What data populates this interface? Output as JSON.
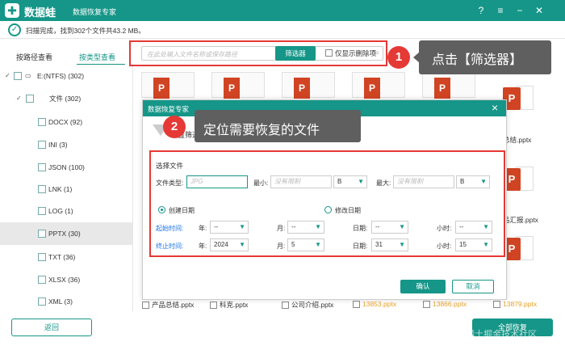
{
  "app": {
    "brand": "数据蛙",
    "title": "数据恢复专家"
  },
  "status": {
    "text": "扫描完成，找到302个文件共43.2 MB。"
  },
  "tabs": [
    {
      "label": "按路径查看"
    },
    {
      "label": "按类型查看"
    }
  ],
  "tree": [
    {
      "label": "E:(NTFS) (302)"
    },
    {
      "label": "文件 (302)"
    },
    {
      "label": "DOCX (92)"
    },
    {
      "label": "INI (3)"
    },
    {
      "label": "JSON (100)"
    },
    {
      "label": "LNK (1)"
    },
    {
      "label": "LOG (1)"
    },
    {
      "label": "PPTX (30)"
    },
    {
      "label": "TXT (36)"
    },
    {
      "label": "XLSX (36)"
    },
    {
      "label": "XML (3)"
    }
  ],
  "toolbar": {
    "search_placeholder": "在此处输入文件名称或保存路径",
    "filter_label": "筛选器",
    "deleted_only_label": "仅显示删除项"
  },
  "callouts": {
    "one_num": "1",
    "one_text": "点击【筛选器】",
    "two_num": "2",
    "two_text": "定位需要恢复的文件"
  },
  "side_files": [
    {
      "label": "总结.pptx"
    },
    {
      "label": "品汇报.pptx"
    }
  ],
  "bottom_files": [
    {
      "label": "产品总结.pptx",
      "orange": false
    },
    {
      "label": "科克.pptx",
      "orange": false
    },
    {
      "label": "公司介绍.pptx",
      "orange": false
    },
    {
      "label": "13853.pptx",
      "orange": true
    },
    {
      "label": "13866.pptx",
      "orange": true
    },
    {
      "label": "13879.pptx",
      "orange": true
    }
  ],
  "buttons": {
    "back": "返回",
    "recover_all": "全部恢复"
  },
  "watermark": "@稀土掘金技术社区",
  "dialog": {
    "title": "数据恢复专家",
    "hint": "设置筛选条件后，找到你的文件",
    "section": "选择文件",
    "file_type_label": "文件类型:",
    "file_type_placeholder": "JPG",
    "min_label": "最小:",
    "min_placeholder": "没有限制",
    "min_unit": "B",
    "max_label": "最大:",
    "max_placeholder": "没有限制",
    "max_unit": "B",
    "created_label": "创建日期",
    "modified_label": "修改日期",
    "start_label": "起始时间:",
    "end_label": "终止时间:",
    "year_label": "年:",
    "month_label": "月:",
    "day_label": "日期:",
    "hour_label": "小时:",
    "start": {
      "year": "--",
      "month": "--",
      "day": "--",
      "hour": "--"
    },
    "end": {
      "year": "2024",
      "month": "5",
      "day": "31",
      "hour": "15"
    },
    "ok": "确认",
    "cancel": "取消"
  }
}
